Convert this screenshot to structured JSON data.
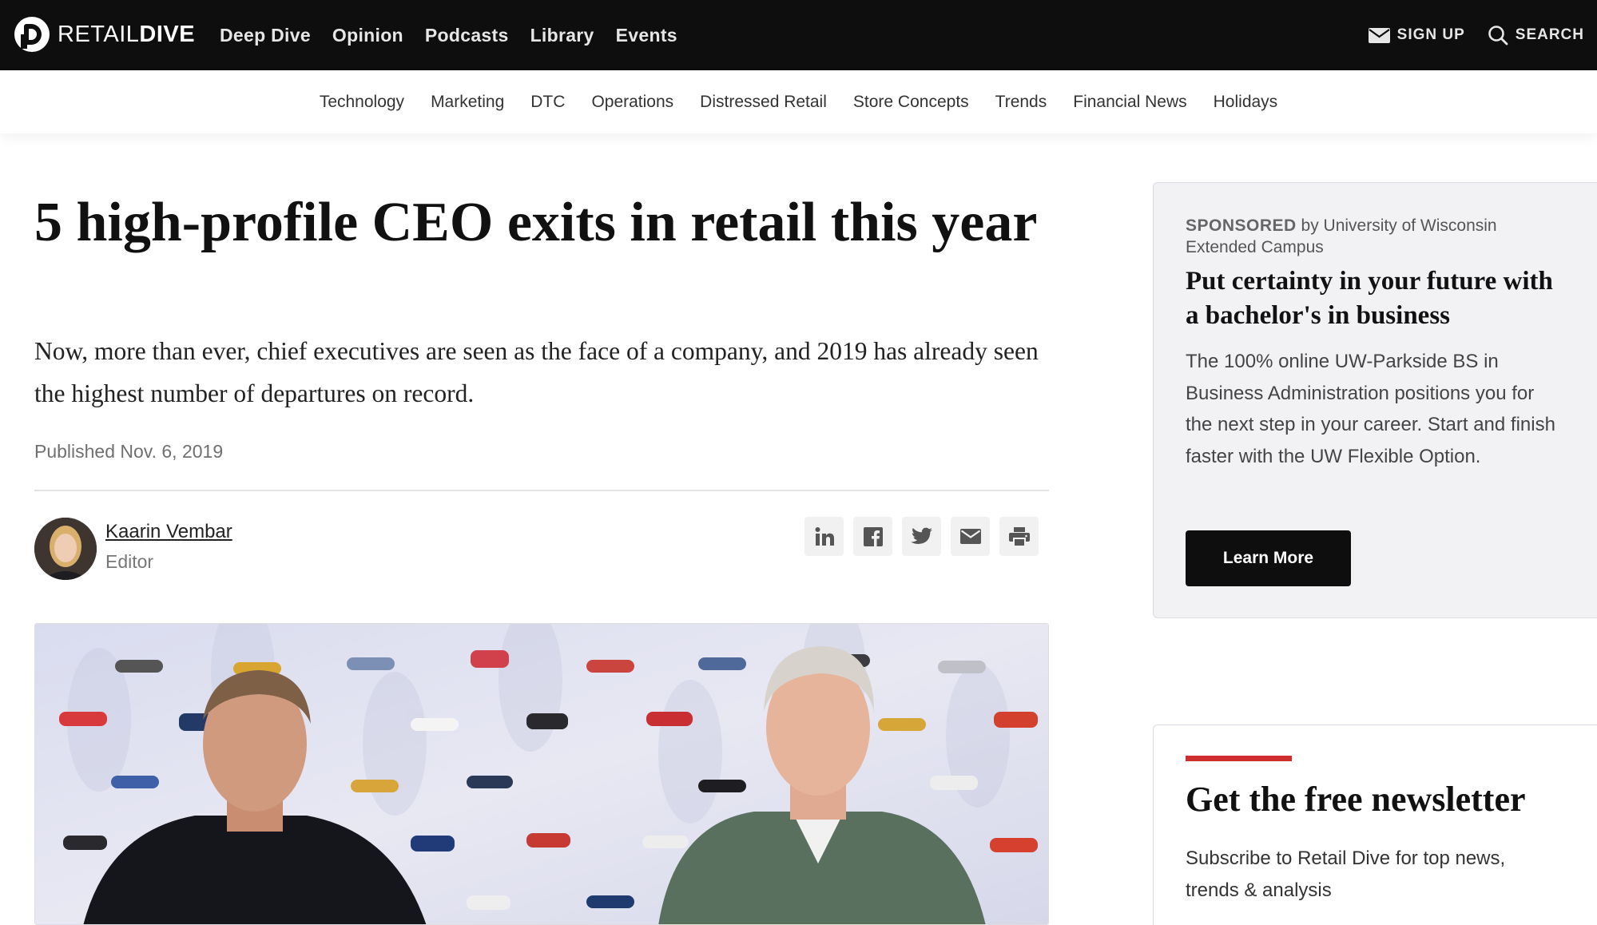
{
  "brand": {
    "retail": "RETAIL",
    "dive": "DIVE"
  },
  "main_nav": [
    "Deep Dive",
    "Opinion",
    "Podcasts",
    "Library",
    "Events"
  ],
  "top_right": {
    "signup": "SIGN UP",
    "search": "SEARCH"
  },
  "sub_nav": [
    "Technology",
    "Marketing",
    "DTC",
    "Operations",
    "Distressed Retail",
    "Store Concepts",
    "Trends",
    "Financial News",
    "Holidays"
  ],
  "article": {
    "headline": "5 high-profile CEO exits in retail this year",
    "dek": "Now, more than ever, chief executives are seen as the face of a company, and 2019 has already seen the highest number of departures on record.",
    "published": "Published Nov. 6, 2019",
    "author": {
      "name": "Kaarin Vembar",
      "role": "Editor"
    },
    "share_icons": [
      "linkedin-icon",
      "facebook-icon",
      "twitter-icon",
      "email-icon",
      "print-icon"
    ]
  },
  "sponsored": {
    "label": "SPONSORED",
    "by": " by University of Wisconsin Extended Campus",
    "title": "Put certainty in your future with a bachelor's in business",
    "body": "The 100% online UW-Parkside BS in Business Administration positions you for the next step in your career. Start and finish faster with the UW Flexible Option.",
    "button": "Learn More"
  },
  "newsletter": {
    "title": "Get the free newsletter",
    "body": "Subscribe to Retail Dive for top news, trends & analysis"
  },
  "colors": {
    "topbar": "#0e0e0e",
    "accent_red": "#cf2e2e",
    "sponsor_bg": "#f2f2f5"
  }
}
